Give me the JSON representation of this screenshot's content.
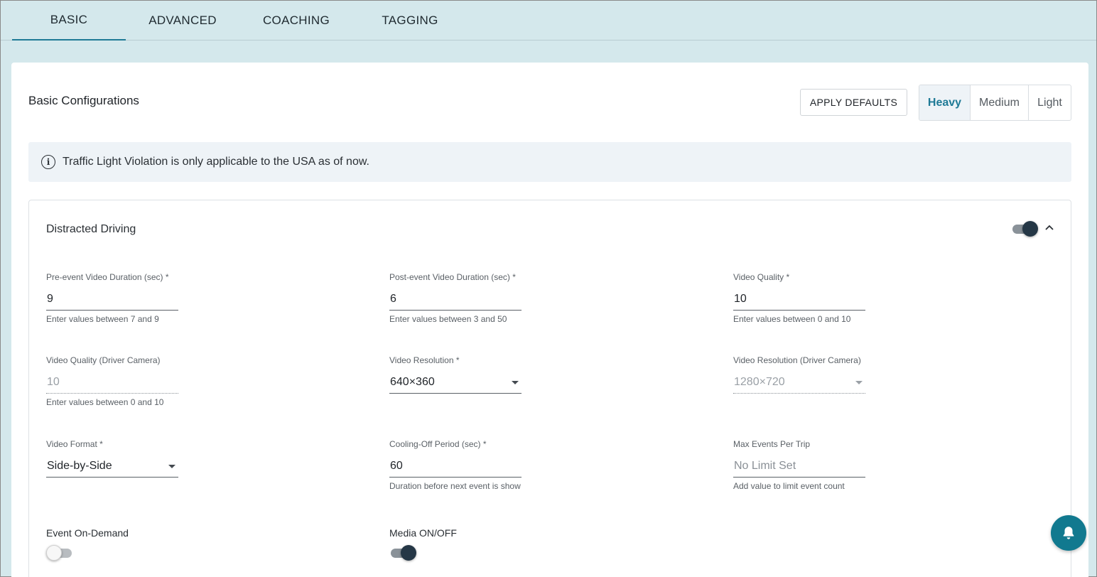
{
  "tabs": [
    {
      "label": "BASIC",
      "active": true
    },
    {
      "label": "ADVANCED",
      "active": false
    },
    {
      "label": "COACHING",
      "active": false
    },
    {
      "label": "TAGGING",
      "active": false
    }
  ],
  "card": {
    "title": "Basic Configurations",
    "apply_defaults_label": "APPLY DEFAULTS",
    "presets": [
      {
        "label": "Heavy",
        "active": true
      },
      {
        "label": "Medium",
        "active": false
      },
      {
        "label": "Light",
        "active": false
      }
    ],
    "info_text": "Traffic Light Violation is only applicable to the USA as of now."
  },
  "section": {
    "title": "Distracted Driving",
    "enabled": true,
    "fields": {
      "pre_event": {
        "label": "Pre-event Video Duration (sec) *",
        "value": "9",
        "helper": "Enter values between 7 and 9"
      },
      "post_event": {
        "label": "Post-event Video Duration (sec) *",
        "value": "6",
        "helper": "Enter values between 3 and 50"
      },
      "video_quality": {
        "label": "Video Quality *",
        "value": "10",
        "helper": "Enter values between 0 and 10"
      },
      "video_quality_driver": {
        "label": "Video Quality (Driver Camera)",
        "value": "10",
        "helper": "Enter values between 0 and 10",
        "disabled": true
      },
      "video_resolution": {
        "label": "Video Resolution *",
        "value": "640×360"
      },
      "video_resolution_driver": {
        "label": "Video Resolution (Driver Camera)",
        "value": "1280×720",
        "disabled": true
      },
      "video_format": {
        "label": "Video Format *",
        "value": "Side-by-Side"
      },
      "cooling_off": {
        "label": "Cooling-Off Period (sec) *",
        "value": "60",
        "helper": "Duration before next event is show"
      },
      "max_events": {
        "label": "Max Events Per Trip",
        "placeholder": "No Limit Set",
        "helper": "Add value to limit event count"
      }
    },
    "switches": {
      "event_on_demand": {
        "label": "Event On-Demand",
        "on": false
      },
      "media": {
        "label": "Media ON/OFF",
        "on": true
      }
    }
  },
  "icons": {
    "info": "info-circle-icon",
    "chevron": "chevron-up-icon",
    "notification": "bell-icon"
  },
  "colors": {
    "accent": "#1f7a96",
    "background": "#d4e8ec",
    "fab": "#11798f",
    "toggle_thumb": "#253746"
  }
}
